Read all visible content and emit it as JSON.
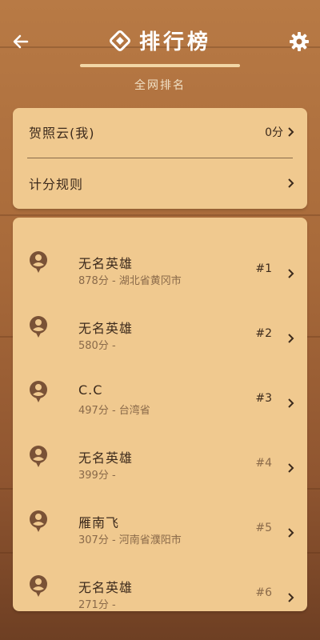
{
  "header": {
    "title": "排行榜",
    "subtitle": "全网排名"
  },
  "summary": {
    "me_label": "贺照云(我)",
    "me_score": "0分",
    "rules_label": "计分规则"
  },
  "players": [
    {
      "name": "无名英雄",
      "info": "878分 - 湖北省黄冈市",
      "rank": "#1"
    },
    {
      "name": "无名英雄",
      "info": "580分 -",
      "rank": "#2"
    },
    {
      "name": "C.C",
      "info": "497分 - 台湾省",
      "rank": "#3"
    },
    {
      "name": "无名英雄",
      "info": "399分 -",
      "rank": "#4"
    },
    {
      "name": "雁南飞",
      "info": "307分 - 河南省濮阳市",
      "rank": "#5"
    },
    {
      "name": "无名英雄",
      "info": "271分 -",
      "rank": "#6"
    }
  ],
  "colors": {
    "card": "#f0c98f",
    "text": "#3c2a1c",
    "muted": "#8a6a4a",
    "wood": "#a86a3a"
  },
  "icons": {
    "back": "arrow-left-icon",
    "settings": "gear-icon",
    "title": "diamond-icon",
    "avatar": "user-icon",
    "chevron": "chevron-right-icon"
  }
}
